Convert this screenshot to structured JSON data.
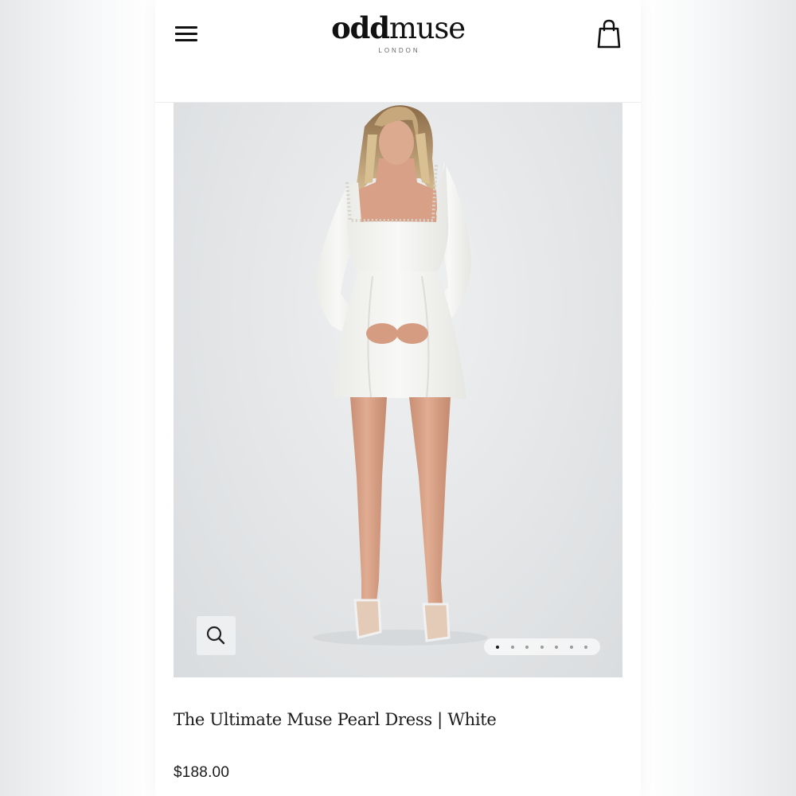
{
  "header": {
    "logo": {
      "bold_part": "odd",
      "light_part": "muse",
      "tagline": "LONDON"
    },
    "menu_icon": "hamburger-menu-icon",
    "bag_icon": "shopping-bag-icon"
  },
  "gallery": {
    "image_alt": "The Ultimate Muse Pearl Dress | White",
    "zoom_icon": "magnifier-icon",
    "slide_count": 7,
    "active_slide": 1
  },
  "product": {
    "title": "The Ultimate Muse Pearl Dress | White",
    "price": "$188.00"
  },
  "colors": {
    "text": "#1b1b1b",
    "photo_background": "#e3e5e7",
    "dress": "#f4f4f2",
    "skin": "#d9a387"
  }
}
